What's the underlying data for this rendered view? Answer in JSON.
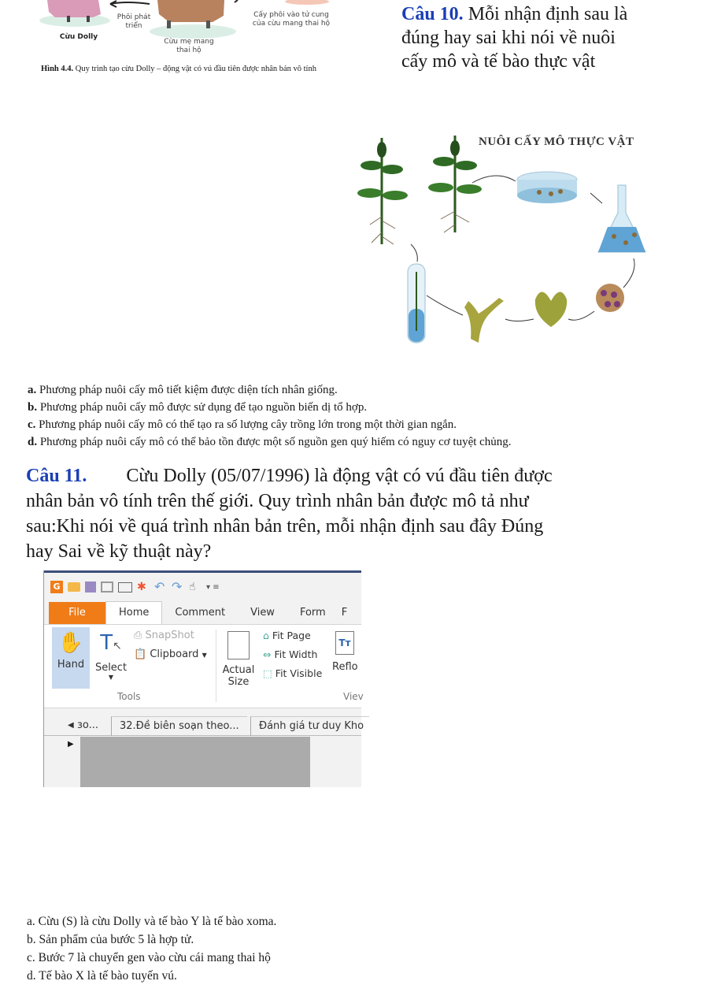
{
  "figure_dolly": {
    "labels": {
      "phoi_phat_trien": "Phôi phát\ntriển",
      "cuu_dolly": "Cừu Dolly",
      "cuu_me": "Cừu mẹ mang\nthai hộ",
      "cay_phoi": "Cấy phôi vào tử cung\ncủa cừu mang thai hộ"
    },
    "caption_bold": "Hình 4.4.",
    "caption_text": " Quy trình tạo cừu Dolly – động vật có vú đầu tiên được nhân bản vô tính"
  },
  "q10": {
    "number": "Câu 10.",
    "line1": " Mỗi nhận định sau là",
    "line2": "đúng hay sai khi nói về nuôi",
    "line3": "cấy mô và tế bào thực vật"
  },
  "figure_tissue": {
    "title": "NUÔI CẤY MÔ THỰC VẬT"
  },
  "q10_options": [
    {
      "letter": "a.",
      "text": " Phương pháp nuôi cấy mô tiết kiệm được diện tích nhân giống."
    },
    {
      "letter": "b.",
      "text": " Phương pháp nuôi cấy mô được sử dụng để tạo nguồn biến dị tổ hợp."
    },
    {
      "letter": "c.",
      "text": " Phương pháp nuôi cấy mô có thể tạo ra số lượng cây trồng lớn trong một thời gian ngắn."
    },
    {
      "letter": "d.",
      "text": " Phương pháp nuôi cấy mô có thể bảo tồn được một số nguồn gen quý hiếm có nguy cơ tuyệt chủng."
    }
  ],
  "q11": {
    "number": "Câu 11.",
    "line1": "Cừu Dolly (05/07/1996) là động vật có vú đầu tiên được",
    "line2": "nhân bản vô tính trên thế giới. Quy trình nhân bản được mô tả như",
    "line3": "sau:Khi nói về quá trình nhân bản trên, mỗi nhận định sau đây Đúng",
    "line4": "hay Sai về kỹ thuật này?"
  },
  "app_screenshot": {
    "quick_access_icons": [
      "app-logo-icon",
      "open-folder-icon",
      "save-icon",
      "print-icon",
      "email-icon",
      "new-icon",
      "undo-icon",
      "redo-icon",
      "touch-mode-icon",
      "customize-icon"
    ],
    "tabs": [
      "File",
      "Home",
      "Comment",
      "View",
      "Form",
      "F"
    ],
    "active_tab": "Home",
    "tools": {
      "hand": "Hand",
      "select": "Select",
      "snapshot": "SnapShot",
      "clipboard": "Clipboard",
      "group": "Tools"
    },
    "view": {
      "actual_size_1": "Actual",
      "actual_size_2": "Size",
      "fit_page": "Fit Page",
      "fit_width": "Fit Width",
      "fit_visible": "Fit Visible",
      "reflow": "Reflo",
      "group": "Viev"
    },
    "doc_tabs": [
      "ɜo...",
      "32.Đề biên soạn theo...",
      "Đánh giá tư duy Kho"
    ]
  },
  "q11_options": [
    "a. Cừu (S) là cừu Dolly và tế bào Y là tế bào xoma.",
    "b. Sản phẩm của bước 5 là hợp tử.",
    "c. Bước 7 là chuyển gen vào cừu cái mang thai hộ",
    "d. Tế bào X là tế bào tuyến vú."
  ]
}
